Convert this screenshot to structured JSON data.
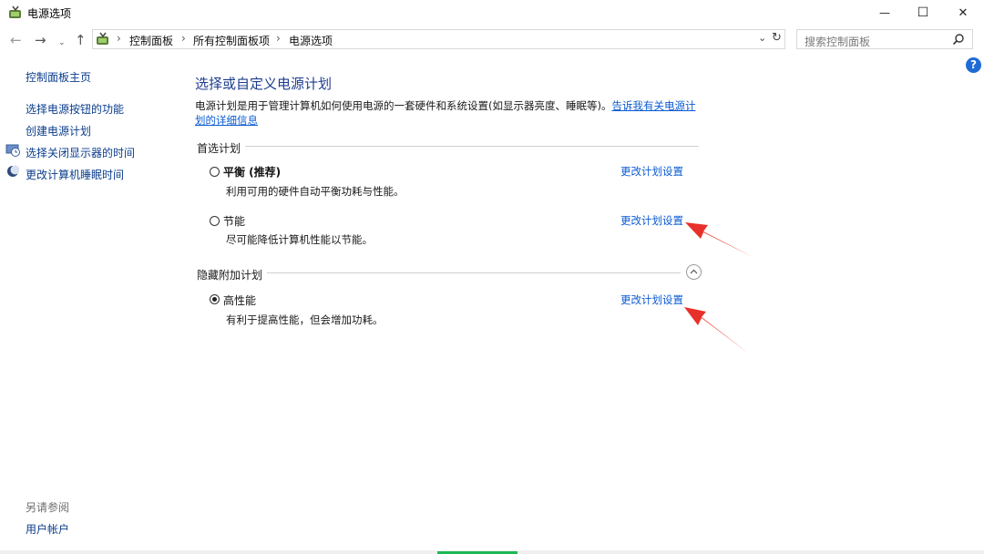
{
  "window": {
    "title": "电源选项",
    "minimize_glyph": "—",
    "maximize_glyph": "☐",
    "close_glyph": "✕"
  },
  "nav": {
    "back_glyph": "←",
    "forward_glyph": "→",
    "recent_glyph": "⌄",
    "up_glyph": "↑",
    "breadcrumbs": [
      "控制面板",
      "所有控制面板项",
      "电源选项"
    ],
    "separator": "›",
    "dropdown_glyph": "⌄",
    "refresh_glyph": "↻",
    "search_placeholder": "搜索控制面板"
  },
  "help_glyph": "?",
  "sidebar": {
    "home": "控制面板主页",
    "items": [
      {
        "label": "选择电源按钮的功能",
        "icon": "none"
      },
      {
        "label": "创建电源计划",
        "icon": "none"
      },
      {
        "label": "选择关闭显示器的时间",
        "icon": "monitor-clock-icon"
      },
      {
        "label": "更改计算机睡眠时间",
        "icon": "moon-icon"
      }
    ],
    "see_also": "另请参阅",
    "user_accounts": "用户帐户"
  },
  "main": {
    "title": "选择或自定义电源计划",
    "description": "电源计划是用于管理计算机如何使用电源的一套硬件和系统设置(如显示器亮度、睡眠等)。",
    "description_link": "告诉我有关电源计划的详细信息",
    "preferred_label": "首选计划",
    "hidden_label": "隐藏附加计划",
    "plans": [
      {
        "name": "平衡 (推荐)",
        "desc": "利用可用的硬件自动平衡功耗与性能。",
        "link": "更改计划设置",
        "selected": false
      },
      {
        "name": "节能",
        "desc": "尽可能降低计算机性能以节能。",
        "link": "更改计划设置",
        "selected": false
      },
      {
        "name": "高性能",
        "desc": "有利于提高性能，但会增加功耗。",
        "link": "更改计划设置",
        "selected": true
      }
    ]
  },
  "colors": {
    "link": "#0b5bd3",
    "title": "#1e3d8f",
    "annotation_arrow": "#e8302a"
  }
}
